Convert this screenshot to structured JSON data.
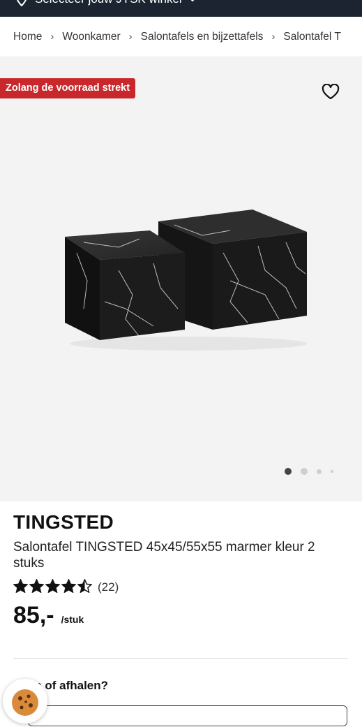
{
  "topbar": {
    "store_label": "Selecteer jouw JYSK winkel",
    "icon": "location-pin-icon"
  },
  "breadcrumb": [
    "Home",
    "Woonkamer",
    "Salontafels en bijzettafels",
    "Salontafel T"
  ],
  "gallery": {
    "badge": "Zolang de voorraad strekt",
    "favorite_icon": "heart-icon",
    "image_index": 1,
    "image_count": 4
  },
  "product": {
    "brand": "TINGSTED",
    "title": "Salontafel TINGSTED 45x45/55x55 marmer kleur 2 stuks",
    "rating_stars": 4.5,
    "rating_count": "(22)",
    "price": "85,-",
    "unit": "/stuk"
  },
  "delivery": {
    "heading": "...ren of afhalen?"
  },
  "cookie": {
    "icon": "cookie-icon"
  },
  "colors": {
    "badge": "#c8282b",
    "topbar": "#1b2430"
  }
}
